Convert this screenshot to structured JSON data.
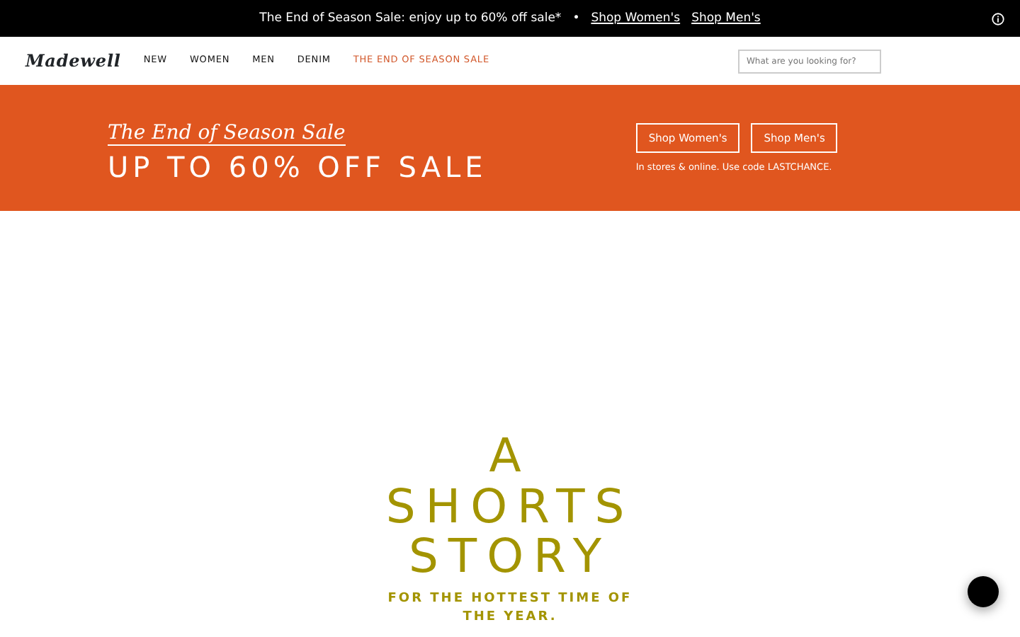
{
  "promo_bar": {
    "text": "The End of Season Sale: enjoy up to 60% off sale*",
    "separator": "•",
    "links": [
      "Shop Women's",
      "Shop Men's"
    ]
  },
  "header": {
    "logo": "Madewell",
    "nav": [
      {
        "label": "NEW",
        "highlighted": false
      },
      {
        "label": "WOMEN",
        "highlighted": false
      },
      {
        "label": "MEN",
        "highlighted": false
      },
      {
        "label": "DENIM",
        "highlighted": false
      },
      {
        "label": "THE END OF SEASON SALE",
        "highlighted": true
      }
    ],
    "search": {
      "placeholder": "What are you looking for?"
    }
  },
  "sale_banner": {
    "script_title": "The End of Season Sale",
    "headline": "UP TO 60% OFF SALE",
    "buttons": [
      "Shop Women's",
      "Shop Men's"
    ],
    "note": "In stores & online. Use code LASTCHANCE."
  },
  "hero": {
    "lines": [
      "A",
      "SHORTS",
      "STORY"
    ],
    "subtitle": "FOR THE HOTTEST TIME OF THE YEAR."
  }
}
